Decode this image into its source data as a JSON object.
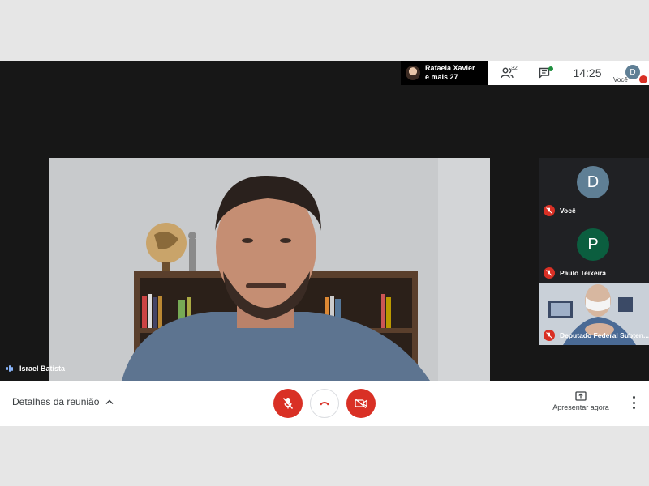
{
  "top_bar": {
    "presenter": {
      "name_line1": "Rafaela Xavier",
      "name_line2": "e mais 27"
    },
    "participants_count": "32",
    "clock": "14:25",
    "self": {
      "initial": "D",
      "label": "Você"
    }
  },
  "main_video": {
    "speaker_name": "Israel Batista",
    "icon": "person-video-feed"
  },
  "side_tiles": [
    {
      "initial": "D",
      "name": "Você",
      "avatar_color": "#5f7f95"
    },
    {
      "initial": "P",
      "name": "Paulo Teixeira",
      "avatar_color": "#0b5e3f"
    },
    {
      "name": "Deputado Federal Subten...",
      "icon": "video-feed"
    }
  ],
  "bottom_bar": {
    "details_label": "Detalhes da reunião",
    "present_label": "Apresentar agora"
  },
  "colors": {
    "danger": "#d93025",
    "stage": "#171717",
    "bar": "#ffffff"
  }
}
